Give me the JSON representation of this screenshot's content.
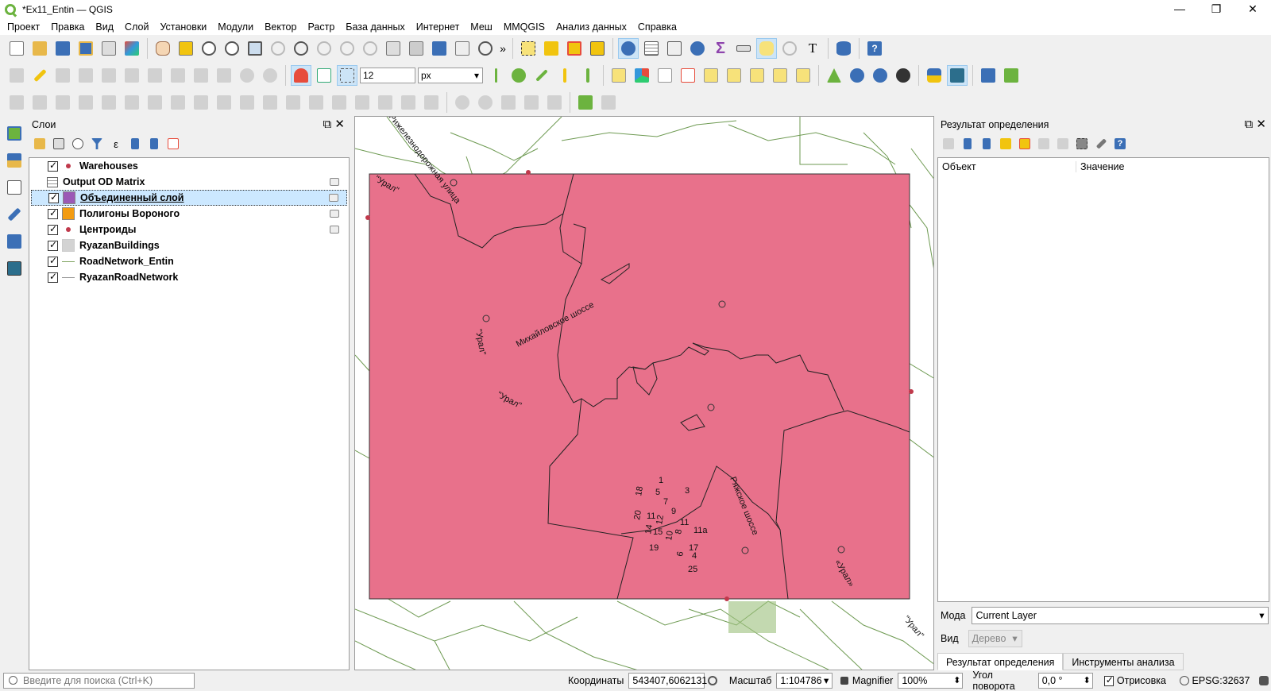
{
  "window": {
    "title": "*Ex11_Entin — QGIS",
    "minimize": "—",
    "restore": "❐",
    "close": "✕"
  },
  "menu": [
    "Проект",
    "Правка",
    "Вид",
    "Слой",
    "Установки",
    "Модули",
    "Вектор",
    "Растр",
    "База данных",
    "Интернет",
    "Меш",
    "MMQGIS",
    "Анализ данных",
    "Справка"
  ],
  "snapping": {
    "tolerance": "12",
    "units": "px"
  },
  "layers_panel": {
    "title": "Слои",
    "float": "⧉",
    "close": "✕",
    "layers": [
      {
        "name": "Warehouses",
        "checked": true,
        "symbol": "dot"
      },
      {
        "name": "Output OD Matrix",
        "checked": false,
        "symbol": "table"
      },
      {
        "name": "Объединенный слой",
        "checked": true,
        "symbol": "fill",
        "color": "#9b59b6"
      },
      {
        "name": "Полигоны Вороного",
        "checked": true,
        "symbol": "fill",
        "color": "#f39c12"
      },
      {
        "name": "Центроиды",
        "checked": true,
        "symbol": "dot"
      },
      {
        "name": "RyazanBuildings",
        "checked": true,
        "symbol": "fill",
        "color": "#d3d3d3"
      },
      {
        "name": "RoadNetwork_Entin",
        "checked": true,
        "symbol": "line"
      },
      {
        "name": "RyazanRoadNetwork",
        "checked": true,
        "symbol": "line-grey"
      }
    ]
  },
  "map": {
    "fill_color": "#e8718b",
    "road_color": "#6e9a52",
    "labels": {
      "rail": "Рижелезнодорожная улица",
      "ural": "\"Урал\"",
      "ural_alt": "«Урал»",
      "mikh": "Михайловское шоссе",
      "ryazh": "Ряжское шоссе"
    },
    "house_numbers": [
      "1",
      "18",
      "5",
      "3",
      "7",
      "20",
      "9",
      "11",
      "12",
      "11",
      "14",
      "15",
      "10",
      "8",
      "11а",
      "19",
      "17",
      "6",
      "4",
      "25"
    ]
  },
  "identify_panel": {
    "title": "Результат определения",
    "float": "⧉",
    "close": "✕",
    "col_feature": "Объект",
    "col_value": "Значение",
    "mode_label": "Мода",
    "mode_value": "Current Layer",
    "view_label": "Вид",
    "view_value": "Дерево",
    "tab_identify": "Результат определения",
    "tab_analysis": "Инструменты анализа"
  },
  "statusbar": {
    "search_placeholder": "Введите для поиска (Ctrl+K)",
    "coord_label": "Координаты",
    "coord_value": "543407,6062131",
    "scale_label": "Масштаб",
    "scale_value": "1:104786",
    "magnifier_label": "Magnifier",
    "magnifier_value": "100%",
    "rotation_label": "Угол поворота",
    "rotation_value": "0,0 °",
    "render_label": "Отрисовка",
    "crs": "EPSG:32637"
  }
}
